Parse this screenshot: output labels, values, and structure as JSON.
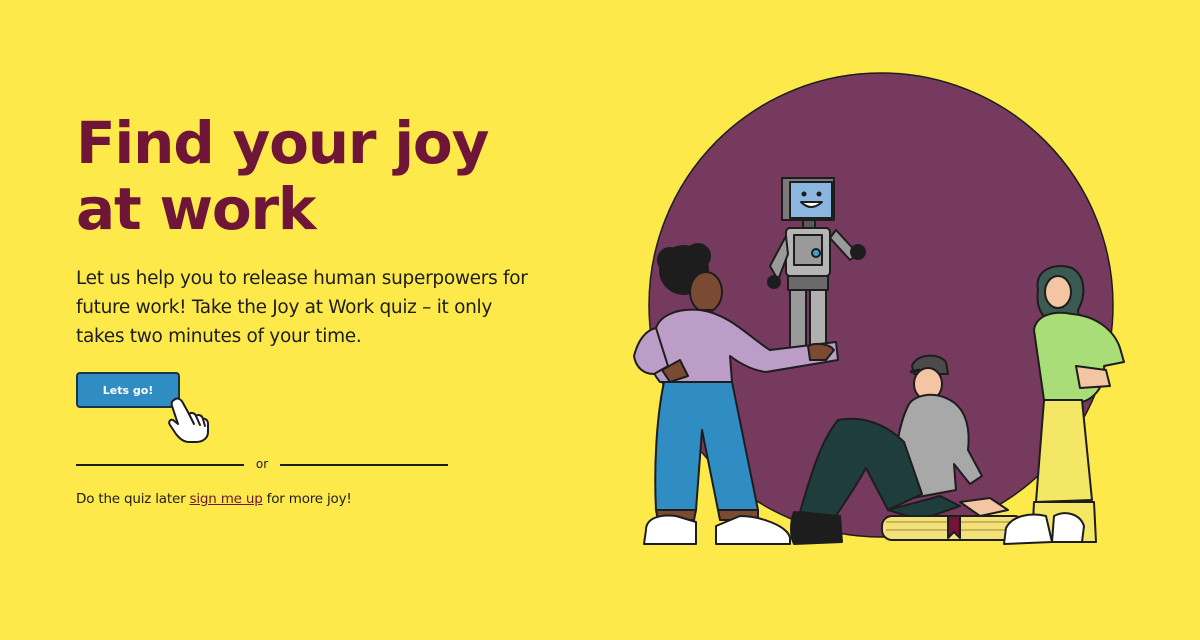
{
  "hero": {
    "title": "Find your joy at work",
    "description": "Let us help you to release human superpowers for future work! Take the Joy at Work quiz – it only takes two minutes of your time."
  },
  "cta": {
    "label": "Lets go!"
  },
  "divider": {
    "label": "or"
  },
  "signup": {
    "prefix": "Do the quiz later ",
    "link_text": "sign me up",
    "suffix": " for more joy!"
  },
  "colors": {
    "background": "#fde94a",
    "title": "#6e1538",
    "button": "#2f8dc4",
    "circle": "#763a5f"
  },
  "icons": {
    "cursor": "pointing-hand-cursor-icon"
  }
}
